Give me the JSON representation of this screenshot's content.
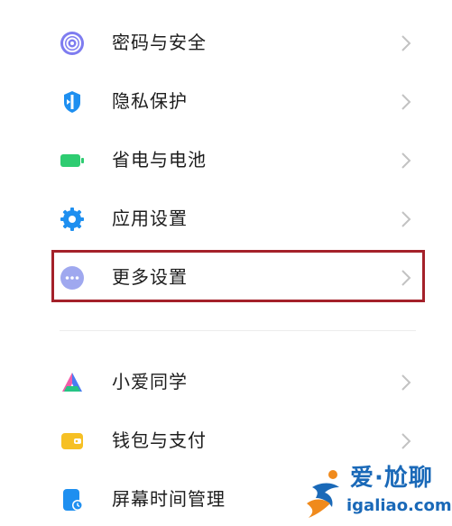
{
  "settings": {
    "items": [
      {
        "label": "密码与安全",
        "icon": "fingerprint-icon"
      },
      {
        "label": "隐私保护",
        "icon": "privacy-shield-icon"
      },
      {
        "label": "省电与电池",
        "icon": "battery-icon"
      },
      {
        "label": "应用设置",
        "icon": "gear-icon"
      },
      {
        "label": "更多设置",
        "icon": "more-dots-icon",
        "highlighted": true
      },
      {
        "label": "小爱同学",
        "icon": "xiaoai-icon"
      },
      {
        "label": "钱包与支付",
        "icon": "wallet-icon"
      },
      {
        "label": "屏幕时间管理",
        "icon": "screen-time-icon"
      }
    ]
  },
  "watermark": {
    "top": "爱·尬聊",
    "bottom": "igaliao.com"
  },
  "colors": {
    "highlight_border": "#a4212a",
    "chevron": "#c2c2c2",
    "watermark_blue": "#1a69b8",
    "watermark_orange": "#f08a1c"
  }
}
